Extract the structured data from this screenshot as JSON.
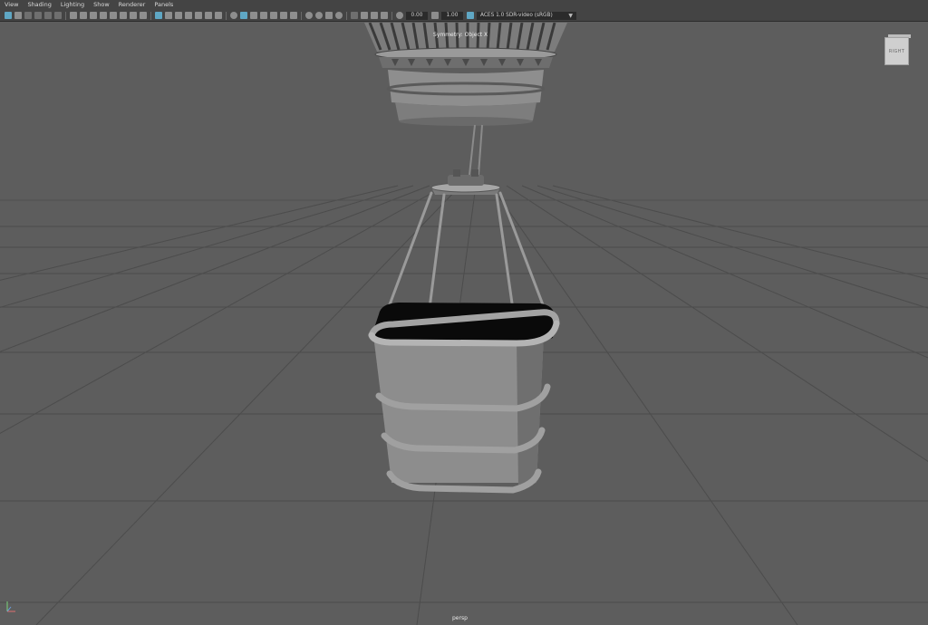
{
  "menu": [
    "View",
    "Shading",
    "Lighting",
    "Show",
    "Renderer",
    "Panels"
  ],
  "toolbar": {
    "exposure_value": "0.00",
    "gamma_value": "1.00",
    "color_space": "ACES 1.0 SDR-video (sRGB)"
  },
  "viewport": {
    "symmetry_label": "Symmetry: Object X",
    "camera_label": "persp",
    "viewcube_label": "RIGHT"
  }
}
